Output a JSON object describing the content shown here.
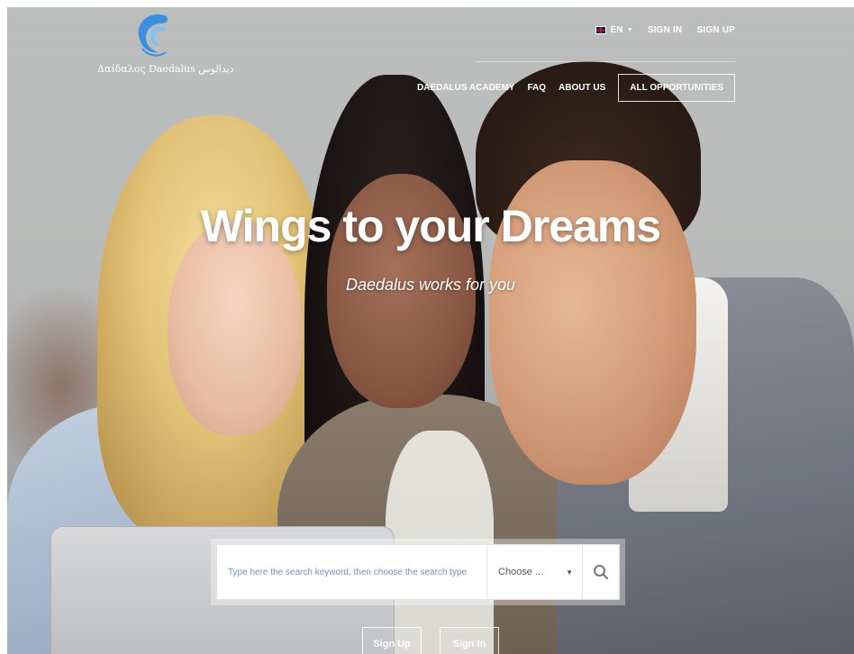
{
  "brand": {
    "logo_text": "Δαίδαλος  Daedalus  ديدالوس"
  },
  "topbar": {
    "language": "EN",
    "sign_in": "SIGN IN",
    "sign_up": "SIGN UP"
  },
  "nav": {
    "items": [
      "DAEDALUS ACADEMY",
      "FAQ",
      "ABOUT US"
    ],
    "all_opportunities": "ALL OPPORTUNITIES"
  },
  "hero": {
    "title": "Wings to your Dreams",
    "subtitle": "Daedalus works for you"
  },
  "search": {
    "placeholder": "Type here the search keyword, then choose the search type",
    "select_value": "Choose ...",
    "icon": "search-icon"
  },
  "actions": {
    "sign_up": "Sign Up",
    "sign_in": "Sign In"
  },
  "colors": {
    "placeholder": "#6a93d2",
    "logo": "#3a8fe0",
    "text_light": "#ffffff"
  }
}
